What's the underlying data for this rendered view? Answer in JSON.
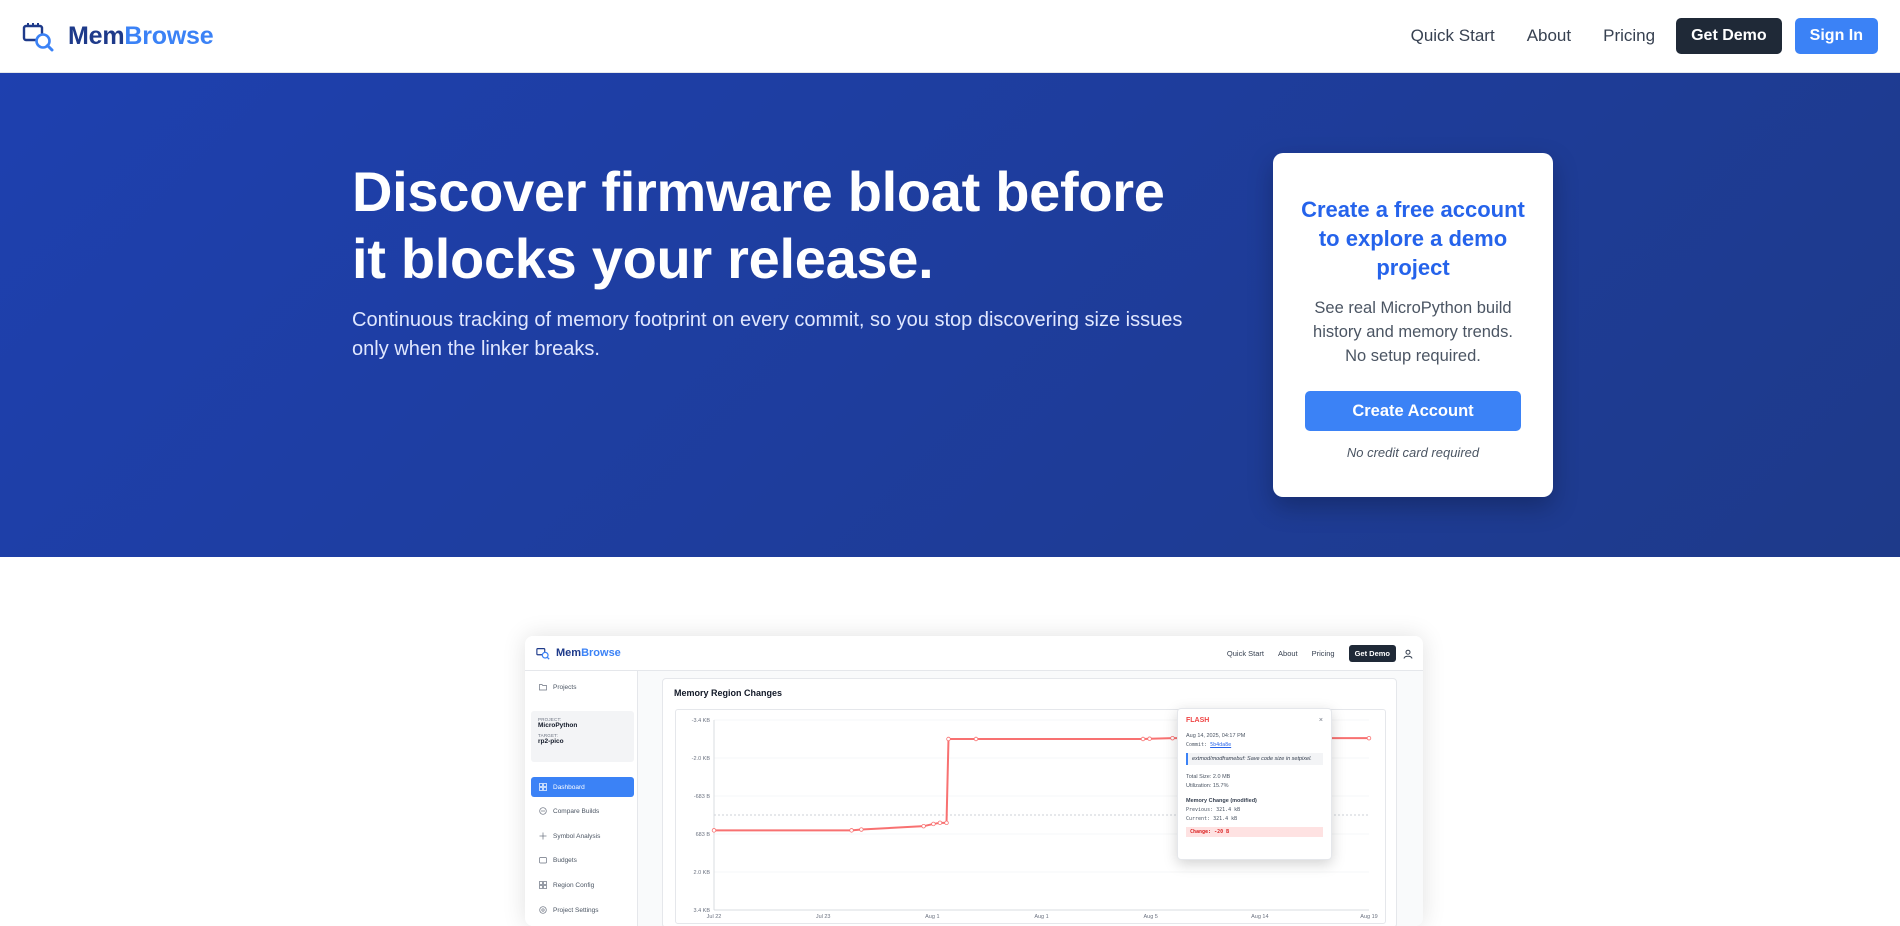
{
  "header": {
    "brand_part1": "Mem",
    "brand_part2": "Browse",
    "nav": [
      "Quick Start",
      "About",
      "Pricing"
    ],
    "demo_label": "Get Demo",
    "signin_label": "Sign In"
  },
  "hero": {
    "title": "Discover firmware bloat before it blocks your release.",
    "subtitle": "Continuous tracking of memory footprint on every commit, so you stop discovering size issues only when the linker breaks."
  },
  "signup_card": {
    "title": "Create a free account to explore a demo project",
    "description": "See real MicroPython build history and memory trends. No setup required.",
    "button_label": "Create Account",
    "note": "No credit card required"
  },
  "preview": {
    "brand_part1": "Mem",
    "brand_part2": "Browse",
    "nav": [
      "Quick Start",
      "About",
      "Pricing"
    ],
    "demo_label": "Get Demo",
    "sidebar": {
      "projects_label": "Projects",
      "project_key": "PROJECT:",
      "project_value": "MicroPython",
      "target_key": "TARGET:",
      "target_value": "rp2-pico",
      "items": [
        "Dashboard",
        "Compare Builds",
        "Symbol Analysis",
        "Budgets",
        "Region Config",
        "Project Settings"
      ]
    },
    "panel_title": "Memory Region Changes",
    "tooltip": {
      "region": "FLASH",
      "close": "×",
      "datetime": "Aug 14, 2025, 04:17 PM",
      "commit_label": "Commit: ",
      "commit_hash": "5b4da8e",
      "message": "extmod/modframebuf: Save code size in setpixel.",
      "total_size": "Total Size: 2.0 MB",
      "utilization": "Utilization: 15.7%",
      "change_title": "Memory Change (modified)",
      "previous": "Previous: 321.4 kB",
      "current": "Current: 321.4 kB",
      "change": "Change: -20 B"
    },
    "chart_data": {
      "type": "line",
      "title": "Memory Region Changes",
      "x": [
        "Jul 22",
        "Jul 23",
        "Aug 1",
        "Aug 1",
        "Aug 5",
        "Aug 14",
        "Aug 19"
      ],
      "y_ticks": [
        "-3.4 KB",
        "-2.0 KB",
        "-683 B",
        "683 B",
        "2.0 KB",
        "3.4 KB"
      ],
      "ylim": [
        -3.4,
        3.4
      ],
      "series": [
        {
          "color": "#f87171",
          "points": [
            [
              0,
              -0.55
            ],
            [
              0.21,
              -0.55
            ],
            [
              0.225,
              -0.52
            ],
            [
              0.32,
              -0.4
            ],
            [
              0.335,
              -0.32
            ],
            [
              0.345,
              -0.28
            ],
            [
              0.355,
              -0.28
            ],
            [
              0.358,
              2.72
            ],
            [
              0.4,
              2.72
            ],
            [
              0.655,
              2.72
            ],
            [
              0.665,
              2.73
            ],
            [
              0.7,
              2.75
            ],
            [
              1.0,
              2.75
            ]
          ]
        }
      ],
      "grid": true,
      "colors": {
        "line": "#f87171",
        "zero_line": "#9ca3af"
      }
    }
  }
}
